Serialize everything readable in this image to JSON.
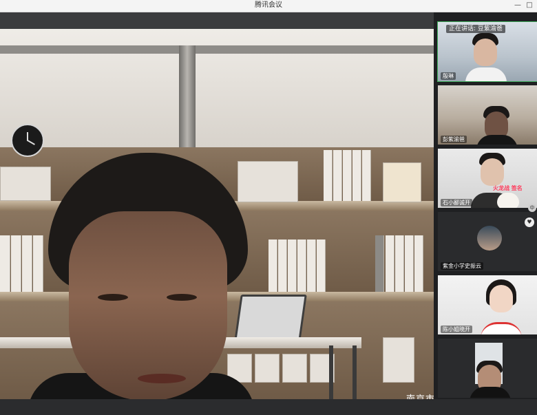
{
  "app": {
    "title": "腾讯会议"
  },
  "window_controls": {
    "minimize": "—",
    "restore": "□"
  },
  "speaker_banner": "正在讲话: 豆紫渝爸",
  "participants": [
    {
      "name": "殷琳"
    },
    {
      "name": "彭紫渝爸"
    },
    {
      "name": "石小鄙诚开"
    },
    {
      "name": "紫金小学史振云"
    },
    {
      "name": "陈小姐晓开"
    },
    {
      "name": ""
    }
  ],
  "overlays": {
    "sticker_text": "火龙战 签名",
    "zh_label": "中",
    "heart_icon": "♥"
  },
  "watermark": "南京市栖霞区栖霞中心小学",
  "colors": {
    "active_border": "#3fae5b",
    "sidebar_bg": "#1f2022",
    "toolbar_bg": "#3b3c3e"
  }
}
